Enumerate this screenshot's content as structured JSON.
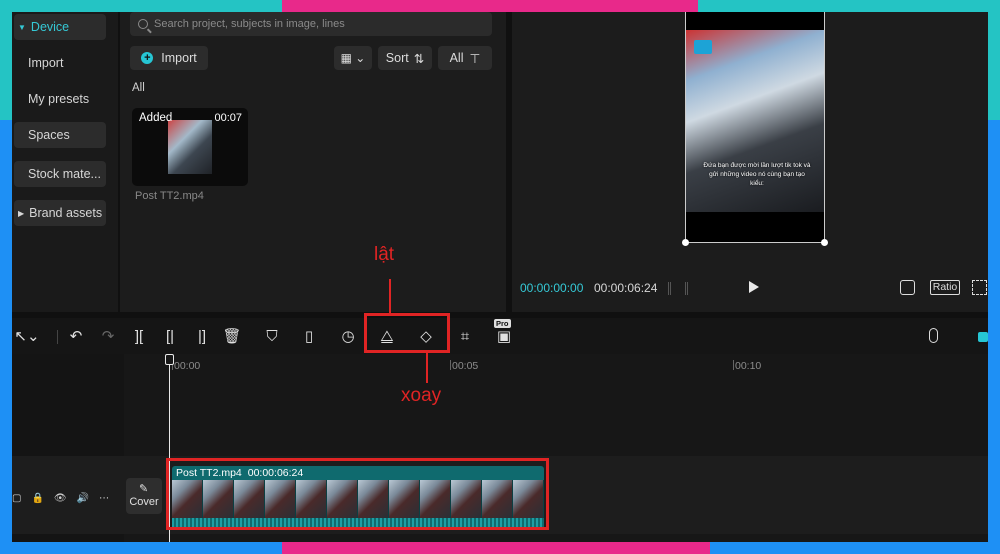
{
  "sidebar": {
    "items": [
      {
        "label": "Device",
        "active": true
      },
      {
        "label": "Import"
      },
      {
        "label": "My presets"
      },
      {
        "label": "Spaces"
      },
      {
        "label": "Stock mate..."
      },
      {
        "label": "Brand assets"
      }
    ]
  },
  "media": {
    "search_placeholder": "Search project, subjects in image, lines",
    "import_label": "Import",
    "sort_label": "Sort",
    "filter_label": "All",
    "section_label": "All",
    "item": {
      "badge": "Added",
      "duration": "00:07",
      "name": "Post TT2.mp4"
    }
  },
  "player": {
    "caption": "Đứa bạn được mời lần lượt tik tok và gửi những video nó cùng bạn tạo kiểu:",
    "current_time": "00:00:00:00",
    "total_time": "00:00:06:24",
    "ratio_label": "Ratio"
  },
  "toolbar": {
    "pro_badge": "Pro"
  },
  "timeline": {
    "ticks": [
      "00:00",
      "00:05",
      "00:10"
    ],
    "cover_label": "Cover",
    "clip": {
      "name": "Post TT2.mp4",
      "duration": "00:00:06:24"
    }
  },
  "annotations": {
    "flip_label": "lật",
    "rotate_label": "xoay"
  },
  "colors": {
    "accent": "#35c9d6",
    "annotation": "#e02424",
    "clip": "#0f6a6e"
  }
}
